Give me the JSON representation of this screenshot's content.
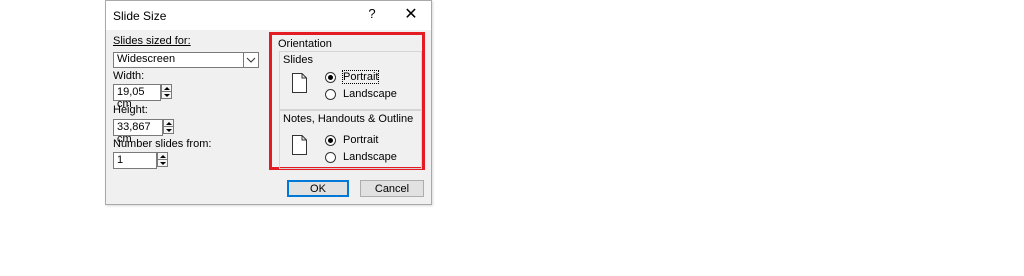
{
  "dialog": {
    "title": "Slide Size",
    "help_glyph": "?",
    "close_glyph": "✕"
  },
  "left": {
    "slides_sized_for_label": "Slides sized for:",
    "slides_sized_for_value": "Widescreen",
    "width_label": "Width:",
    "width_value": "19,05 cm",
    "height_label": "Height:",
    "height_value": "33,867 cm",
    "number_from_label": "Number slides from:",
    "number_from_value": "1"
  },
  "orientation": {
    "title": "Orientation",
    "slides": {
      "title": "Slides",
      "options": [
        "Portrait",
        "Landscape"
      ],
      "selected": "Portrait"
    },
    "notes": {
      "title": "Notes, Handouts & Outline",
      "options": [
        "Portrait",
        "Landscape"
      ],
      "selected": "Portrait"
    }
  },
  "buttons": {
    "ok": "OK",
    "cancel": "Cancel"
  },
  "colors": {
    "highlight": "#e51b24",
    "dialog_bg": "#f0f0f0",
    "default_button": "#0078d7"
  }
}
